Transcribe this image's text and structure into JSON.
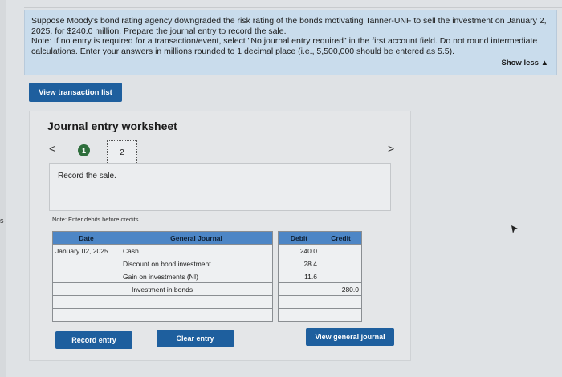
{
  "question": {
    "line1": "Suppose Moody's bond rating agency downgraded the risk rating of the bonds motivating Tanner-UNF to sell the investment on January 2, 2025, for $240.0 million. Prepare the journal entry to record the sale.",
    "line2": "Note: If no entry is required for a transaction/event, select \"No journal entry required\" in the first account field. Do not round intermediate calculations. Enter your answers in millions rounded to 1 decimal place (i.e., 5,500,000 should be entered as 5.5).",
    "show_less": "Show less ▲"
  },
  "view_transaction_list": "View transaction list",
  "worksheet": {
    "title": "Journal entry worksheet",
    "prev": "<",
    "next": ">",
    "step1": "1",
    "step2": "2",
    "instruction": "Record the sale.",
    "note": "Note: Enter debits before credits."
  },
  "table": {
    "headers": {
      "date": "Date",
      "general_journal": "General Journal",
      "debit": "Debit",
      "credit": "Credit"
    },
    "rows": [
      {
        "date": "January 02, 2025",
        "account": "Cash",
        "debit": "240.0",
        "credit": ""
      },
      {
        "date": "",
        "account": "Discount on bond investment",
        "debit": "28.4",
        "credit": ""
      },
      {
        "date": "",
        "account": "Gain on investments (NI)",
        "debit": "11.6",
        "credit": ""
      },
      {
        "date": "",
        "account": "Investment in bonds",
        "debit": "",
        "credit": "280.0"
      },
      {
        "date": "",
        "account": "",
        "debit": "",
        "credit": ""
      },
      {
        "date": "",
        "account": "",
        "debit": "",
        "credit": ""
      }
    ]
  },
  "buttons": {
    "record_entry": "Record entry",
    "clear_entry": "Clear entry",
    "view_general_journal": "View general journal"
  },
  "edge_mark": "s"
}
